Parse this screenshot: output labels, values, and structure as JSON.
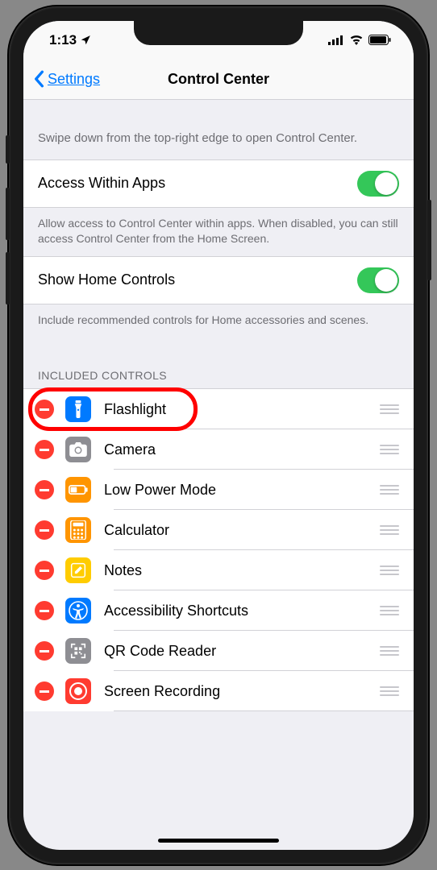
{
  "status": {
    "time": "1:13",
    "signal_bars": 4,
    "wifi": true,
    "battery": 95
  },
  "nav": {
    "back_label": "Settings",
    "title": "Control Center"
  },
  "intro_text": "Swipe down from the top-right edge to open Control Center.",
  "settings": {
    "access_within_apps": {
      "label": "Access Within Apps",
      "value": true
    },
    "access_footer": "Allow access to Control Center within apps. When disabled, you can still access Control Center from the Home Screen.",
    "show_home": {
      "label": "Show Home Controls",
      "value": true
    },
    "show_home_footer": "Include recommended controls for Home accessories and scenes."
  },
  "included_section_header": "INCLUDED CONTROLS",
  "included": [
    {
      "id": "flashlight",
      "label": "Flashlight",
      "icon": "flashlight-icon",
      "bg": "#007aff",
      "highlighted": true
    },
    {
      "id": "camera",
      "label": "Camera",
      "icon": "camera-icon",
      "bg": "#8e8e93"
    },
    {
      "id": "low-power",
      "label": "Low Power Mode",
      "icon": "battery-icon",
      "bg": "#ff9500"
    },
    {
      "id": "calculator",
      "label": "Calculator",
      "icon": "calculator-icon",
      "bg": "#ff9500"
    },
    {
      "id": "notes",
      "label": "Notes",
      "icon": "notes-icon",
      "bg": "#ffcc00"
    },
    {
      "id": "accessibility",
      "label": "Accessibility Shortcuts",
      "icon": "accessibility-icon",
      "bg": "#007aff"
    },
    {
      "id": "qr",
      "label": "QR Code Reader",
      "icon": "qr-icon",
      "bg": "#8e8e93"
    },
    {
      "id": "screen-rec",
      "label": "Screen Recording",
      "icon": "record-icon",
      "bg": "#ff3b30"
    }
  ]
}
